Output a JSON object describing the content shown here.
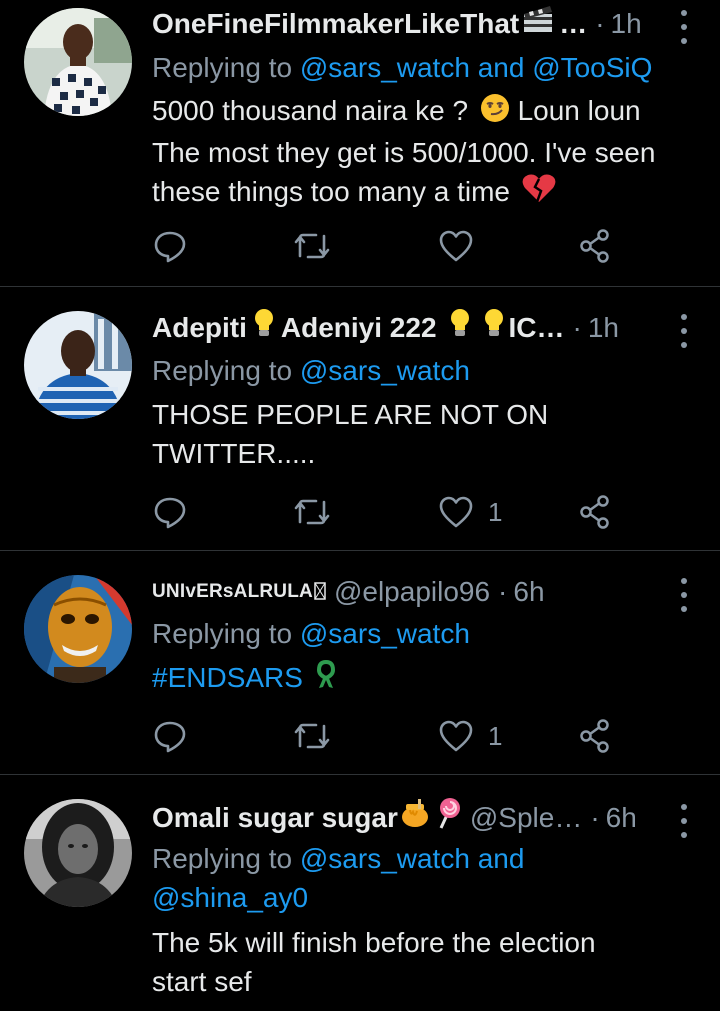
{
  "tweets": [
    {
      "name": "OneFineFilmmakerLikeThat",
      "ellipsis": "…",
      "time": "1h",
      "replying_prefix": "Replying to ",
      "replying_mentions": "@sars_watch and @TooSiQ",
      "text_lines": [
        "5000 thousand naira ke ?",
        "Loun loun",
        "The most they get is 500/1000. I've seen",
        "these things too many a time"
      ],
      "like_count": ""
    },
    {
      "name": "Adepiti",
      "name_part2": "Adeniyi 222",
      "name_part3": "IC…",
      "time": "1h",
      "replying_prefix": "Replying to ",
      "replying_mentions": "@sars_watch",
      "text_lines": [
        "THOSE PEOPLE ARE NOT ON",
        "TWITTER....."
      ],
      "like_count": "1"
    },
    {
      "name": "UNIvERsALRULA",
      "handle": "@elpapilo96",
      "time": "6h",
      "replying_prefix": "Replying to ",
      "replying_mentions": "@sars_watch",
      "hashtag": "#ENDSARS",
      "like_count": "1"
    },
    {
      "name": "Omali sugar sugar",
      "handle": "@Sple…",
      "time": "6h",
      "replying_prefix": "Replying to ",
      "replying_mentions_line1": "@sars_watch and",
      "replying_mentions_line2": "@shina_ay0",
      "text_lines": [
        "The 5k will finish before the election",
        "start sef"
      ]
    }
  ],
  "separator": "·",
  "colors": {
    "background": "#000000",
    "text": "#e7e9ea",
    "muted": "#8b98a5",
    "link": "#1d9bf0",
    "divider": "#2f3336"
  },
  "icons": [
    "reply-icon",
    "retweet-icon",
    "like-icon",
    "share-icon",
    "more-icon",
    "clapper-emoji",
    "smirk-emoji",
    "broken-heart-emoji",
    "lightbulb-emoji",
    "honey-pot-emoji",
    "lollipop-emoji",
    "green-ribbon-emoji"
  ]
}
